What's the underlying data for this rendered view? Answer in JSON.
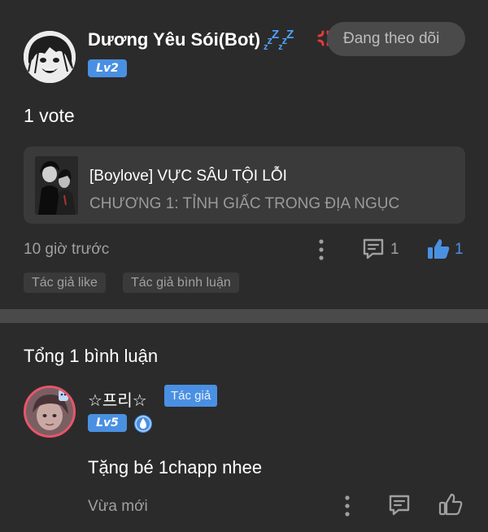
{
  "post": {
    "author": {
      "name": "Dương Yêu Sói(Bot)",
      "zzz": "zzZzzZ",
      "level": "Lv2"
    },
    "follow_button": "Đang theo dõi",
    "vote_text": "1 vote",
    "story": {
      "title": "[Boylove] VỰC SÂU TỘI LỖI",
      "chapter": "CHƯƠNG 1: TỈNH GIẤC TRONG ĐỊA NGỤC"
    },
    "time": "10 giờ trước",
    "comment_count": "1",
    "like_count": "1",
    "tags": [
      "Tác giả like",
      "Tác giả bình luận"
    ]
  },
  "comments_section": {
    "title": "Tổng 1 bình luận",
    "comments": [
      {
        "name": "☆프리☆",
        "author_tag": "Tác giả",
        "level": "Lv5",
        "text": "Tặng bé 1chapp nhee",
        "time": "Vừa mới"
      }
    ]
  },
  "colors": {
    "background": "#2b2b2b",
    "card": "#3a3a3a",
    "accent_blue": "#4a90e2",
    "muted_text": "#a0a0a0",
    "divider": "#4a4a4a",
    "anger_red": "#e23b3b"
  },
  "icons": {
    "more": "more-vertical-icon",
    "comment": "comment-icon",
    "like": "thumbs-up-icon",
    "anger": "anger-symbol-icon",
    "level_drop": "water-drop-icon"
  }
}
